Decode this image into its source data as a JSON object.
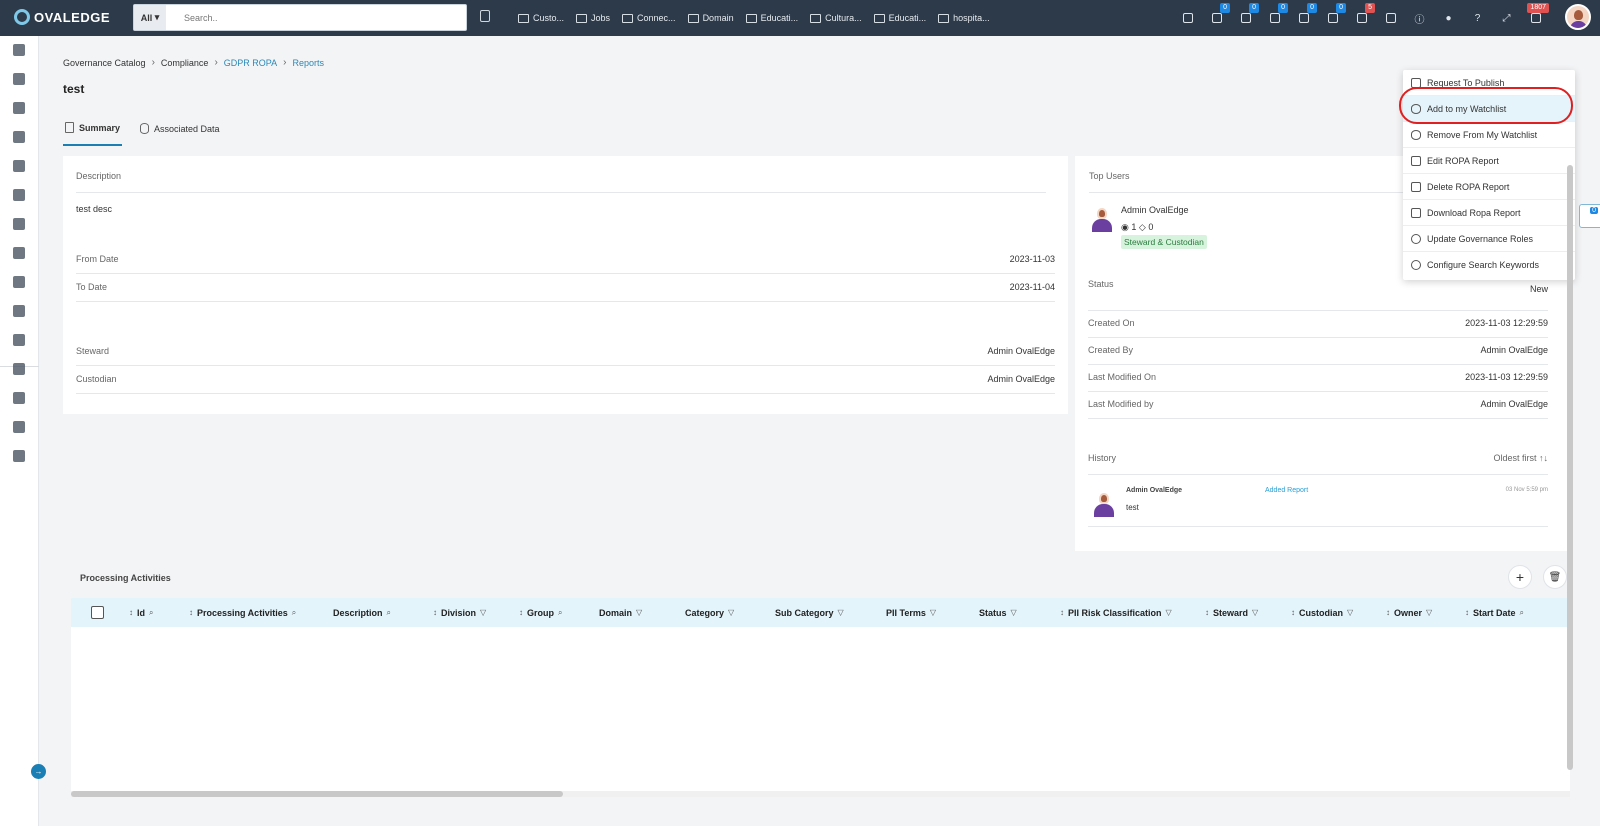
{
  "app": {
    "name": "OVALEDGE"
  },
  "topbar": {
    "search_scope": "All",
    "search_placeholder": "Search..",
    "quick_links": [
      "Custo...",
      "Jobs",
      "Connec...",
      "Domain",
      "Educati...",
      "Cultura...",
      "Educati...",
      "hospita..."
    ],
    "icon_badges": [
      "0",
      "0",
      "0",
      "0",
      "0",
      "5",
      "1807"
    ]
  },
  "breadcrumb": {
    "items": [
      "Governance Catalog",
      "Compliance",
      "GDPR ROPA",
      "Reports"
    ]
  },
  "page": {
    "title": "test"
  },
  "tabs": [
    {
      "label": "Summary",
      "active": true
    },
    {
      "label": "Associated Data",
      "active": false
    }
  ],
  "summary": {
    "description_label": "Description",
    "description_value": "test desc",
    "from_date_label": "From Date",
    "from_date_value": "2023-11-03",
    "to_date_label": "To Date",
    "to_date_value": "2023-11-04",
    "steward_label": "Steward",
    "steward_value": "Admin OvalEdge",
    "custodian_label": "Custodian",
    "custodian_value": "Admin OvalEdge"
  },
  "top_users": {
    "title": "Top Users",
    "user_name": "Admin OvalEdge",
    "views": "1",
    "likes": "0",
    "role_tag": "Steward & Custodian"
  },
  "details": {
    "status_label": "Status",
    "status_value": "New",
    "created_on_label": "Created On",
    "created_on_value": "2023-11-03 12:29:59",
    "created_by_label": "Created By",
    "created_by_value": "Admin OvalEdge",
    "last_modified_on_label": "Last Modified On",
    "last_modified_on_value": "2023-11-03 12:29:59",
    "last_modified_by_label": "Last Modified by",
    "last_modified_by_value": "Admin OvalEdge"
  },
  "history": {
    "title": "History",
    "sort_label": "Oldest first",
    "entry_user": "Admin OvalEdge",
    "entry_action": "Added Report",
    "entry_time": "03 Nov 5:59 pm",
    "entry_text": "test"
  },
  "menu": {
    "items": [
      "Request To Publish",
      "Add to my Watchlist",
      "Remove From My Watchlist",
      "Edit ROPA Report",
      "Delete ROPA Report",
      "Download Ropa Report",
      "Update Governance Roles",
      "Configure Search Keywords"
    ],
    "side_badge": "0"
  },
  "processing": {
    "title": "Processing Activities",
    "columns": [
      "Id",
      "Processing Activities",
      "Description",
      "Division",
      "Group",
      "Domain",
      "Category",
      "Sub Category",
      "PII Terms",
      "Status",
      "PII Risk Classification",
      "Steward",
      "Custodian",
      "Owner",
      "Start Date"
    ]
  }
}
